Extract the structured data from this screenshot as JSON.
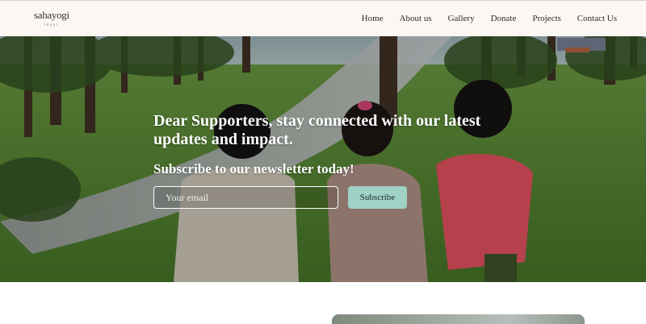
{
  "brand": {
    "logo_text": "sahayogi",
    "logo_sub": "TRUST"
  },
  "nav": {
    "items": [
      {
        "label": "Home"
      },
      {
        "label": "About us"
      },
      {
        "label": "Gallery"
      },
      {
        "label": "Donate"
      },
      {
        "label": "Projects"
      },
      {
        "label": "Contact Us"
      }
    ]
  },
  "hero": {
    "heading": "Dear Supporters, stay connected with our latest updates and impact.",
    "subheading": "Subscribe to our newsletter today!",
    "email_placeholder": "Your email",
    "email_value": "",
    "subscribe_label": "Subscribe"
  },
  "colors": {
    "header_bg": "#fbf8f4",
    "accent_button": "#9fd1c4",
    "hero_text": "#ffffff"
  }
}
